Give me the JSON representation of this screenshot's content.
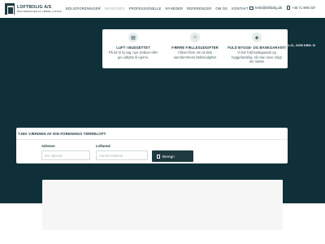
{
  "header": {
    "logo": {
      "name": "LOFTBOLIG A/S",
      "tagline": "BOFORENINGER AF TØRRE LOFTER"
    },
    "nav": [
      {
        "label": "BOLIGFORENINGER",
        "active": false
      },
      {
        "label": "BEREGNER",
        "active": true
      },
      {
        "label": "PROFESSIONELLE",
        "active": false
      },
      {
        "label": "NYHEDER",
        "active": false
      },
      {
        "label": "REFERENCER",
        "active": false
      },
      {
        "label": "OM OS",
        "active": false
      },
      {
        "label": "KONTAKT",
        "active": false
      }
    ],
    "email": "hello@loftbolig.dk",
    "phone": "+45 71 906 037"
  },
  "features": [
    {
      "icon": "building-icon",
      "title": "LUFT I BUDGETTET",
      "description": "På tid til ny tag, nye vinduer eller giv udbytte til ejerne."
    },
    {
      "icon": "community-icon",
      "title": "FÆRRE FÆLLESUDGIFTER",
      "description": "I bliver flere om at dele ejendommens fællesudgifter"
    },
    {
      "icon": "shield-icon",
      "title": "FULD BYGGE- OG BANKGARANTI",
      "description": "Vi har fuld bankgaranti og byggefardelig, så man sove roligt om natten"
    }
  ],
  "address_strip": "1-11, 2200 KBH. N",
  "calculator": {
    "title": "TJEK VÆRDIEN AF DIN FORENINGS TØRRELOFT",
    "address_label": "Adresse",
    "address_placeholder": "Din adresse",
    "area_label": "Loftareal",
    "area_placeholder": "Samlet loftareal",
    "button_label": "Beregn"
  },
  "colors": {
    "brand_dark": "#0f3038",
    "brand_text": "#1e3a40",
    "nav_active": "#9bb0b3"
  }
}
